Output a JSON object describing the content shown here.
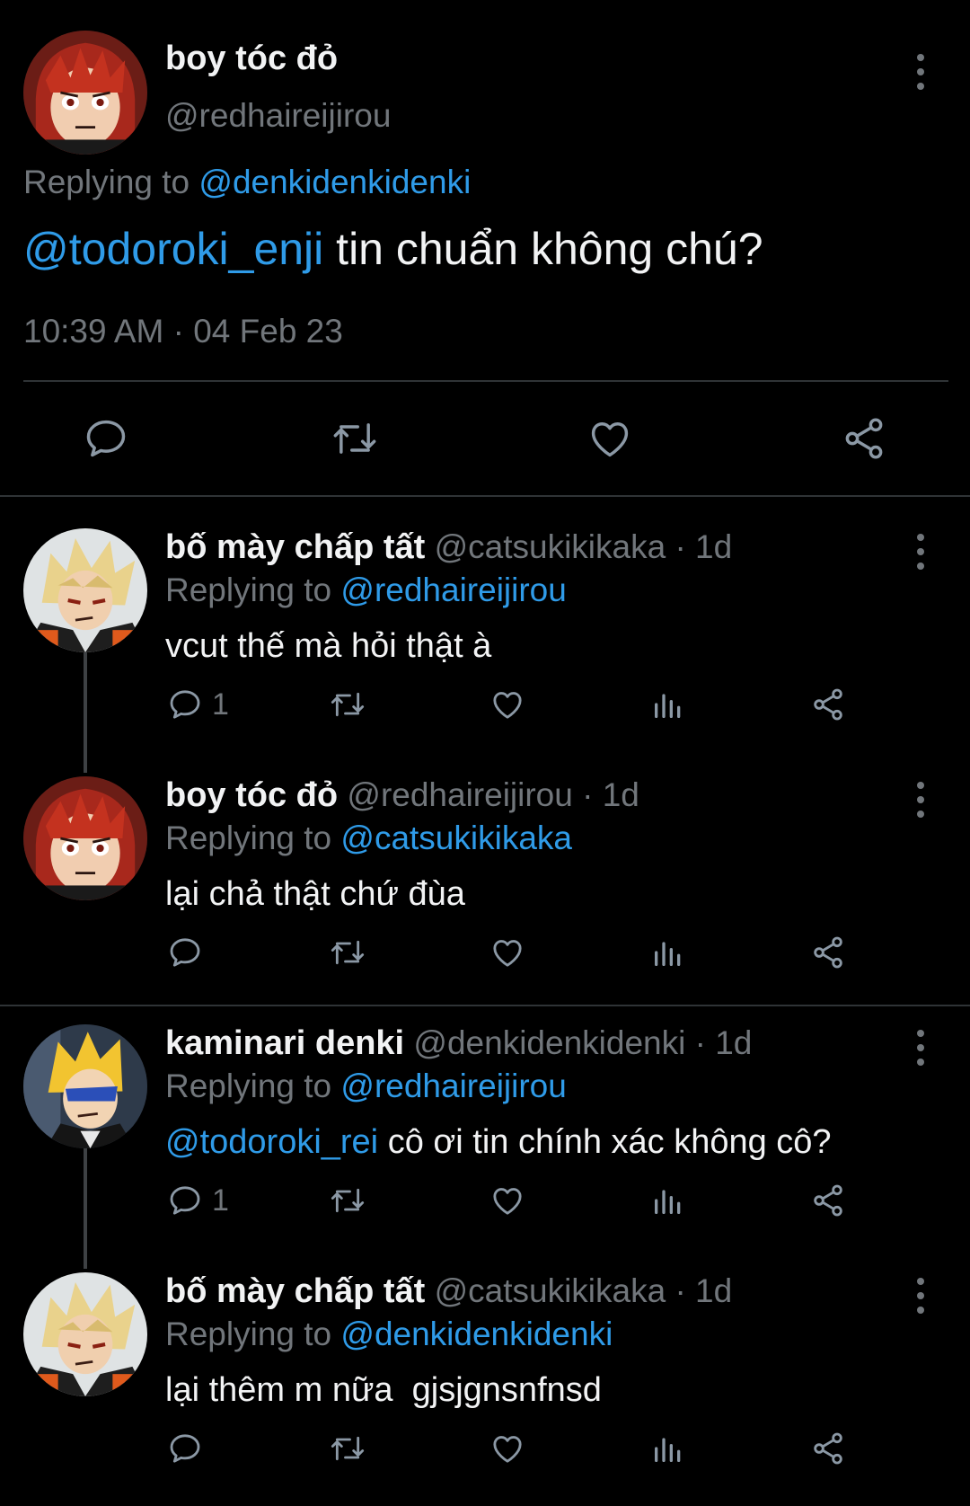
{
  "main": {
    "name": "boy tóc đỏ",
    "handle": "@redhaireijirou",
    "replying_prefix": "Replying to ",
    "replying_to": "@denkidenkidenki",
    "mention": "@todoroki_enji",
    "text": " tin chuẩn không chú?",
    "timestamp": "10:39 AM · 04 Feb 23"
  },
  "replies": [
    {
      "name": "bố mày chấp tất",
      "meta": " @catsukikikaka · 1d",
      "replying_prefix": "Replying to ",
      "replying_to": "@redhaireijirou",
      "mention": "",
      "text": "vcut thế mà hỏi thật à",
      "reply_count": "1",
      "avatar": "blonde-spiky-avatar"
    },
    {
      "name": "boy tóc đỏ",
      "meta": " @redhaireijirou · 1d",
      "replying_prefix": "Replying to ",
      "replying_to": "@catsukikikaka",
      "mention": "",
      "text": "lại chả thật chứ đùa",
      "reply_count": "",
      "avatar": "redhair-avatar"
    },
    {
      "name": "kaminari denki",
      "meta": " @denkidenkidenki · 1d",
      "replying_prefix": "Replying to ",
      "replying_to": "@redhaireijirou",
      "mention": "@todoroki_rei",
      "text": " cô ơi tin chính xác không cô?",
      "reply_count": "1",
      "avatar": "yellowhair-avatar"
    },
    {
      "name": "bố mày chấp tất",
      "meta": " @catsukikikaka · 1d",
      "replying_prefix": "Replying to ",
      "replying_to": "@denkidenkidenki",
      "mention": "",
      "text": "lại thêm m nữa  gjsjgnsnfnsd",
      "reply_count": "",
      "avatar": "blonde-spiky-avatar"
    }
  ],
  "colors": {
    "background": "#000000",
    "link": "#2f9be8",
    "muted": "#71767b",
    "text": "#f2f3f4"
  }
}
